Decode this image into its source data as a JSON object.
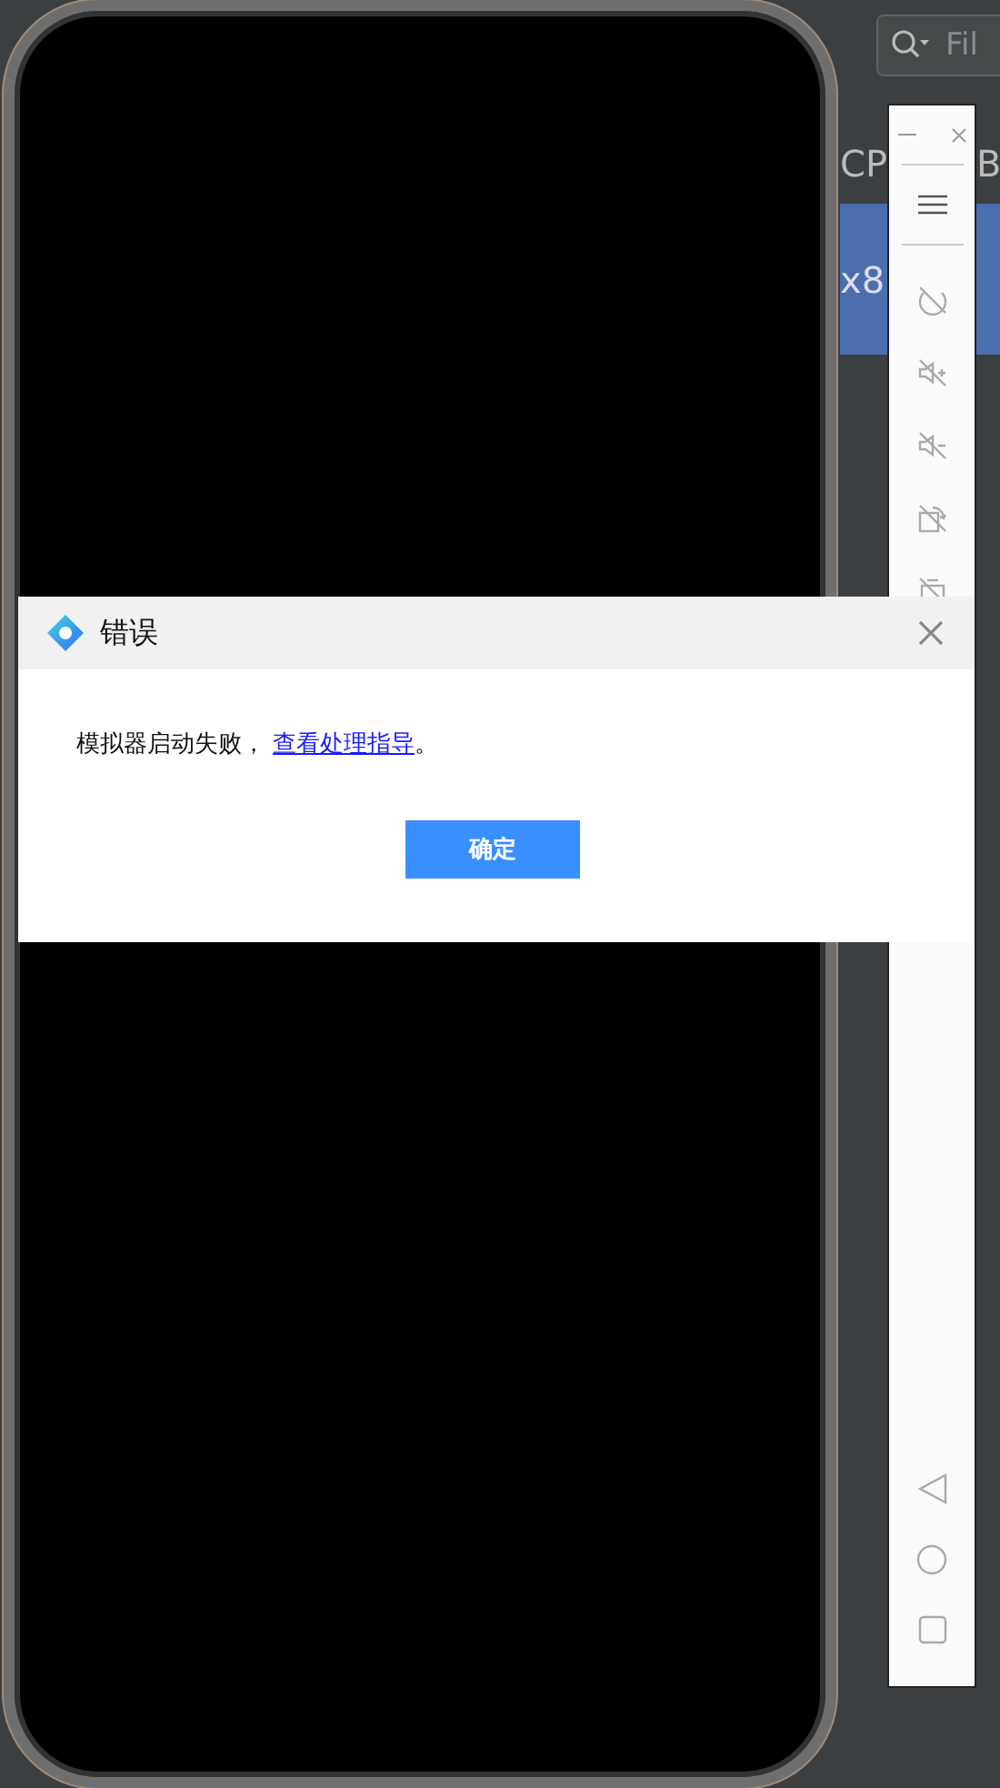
{
  "ide": {
    "search": {
      "placeholder": "Fil"
    },
    "columns": [
      "CP",
      "B"
    ],
    "rows": [
      {
        "cell": "x8",
        "selected": true
      }
    ]
  },
  "dialog": {
    "title": "错误",
    "message": "模拟器启动失败，",
    "link": "查看处理指导",
    "message_end": "。",
    "button": "确定"
  }
}
